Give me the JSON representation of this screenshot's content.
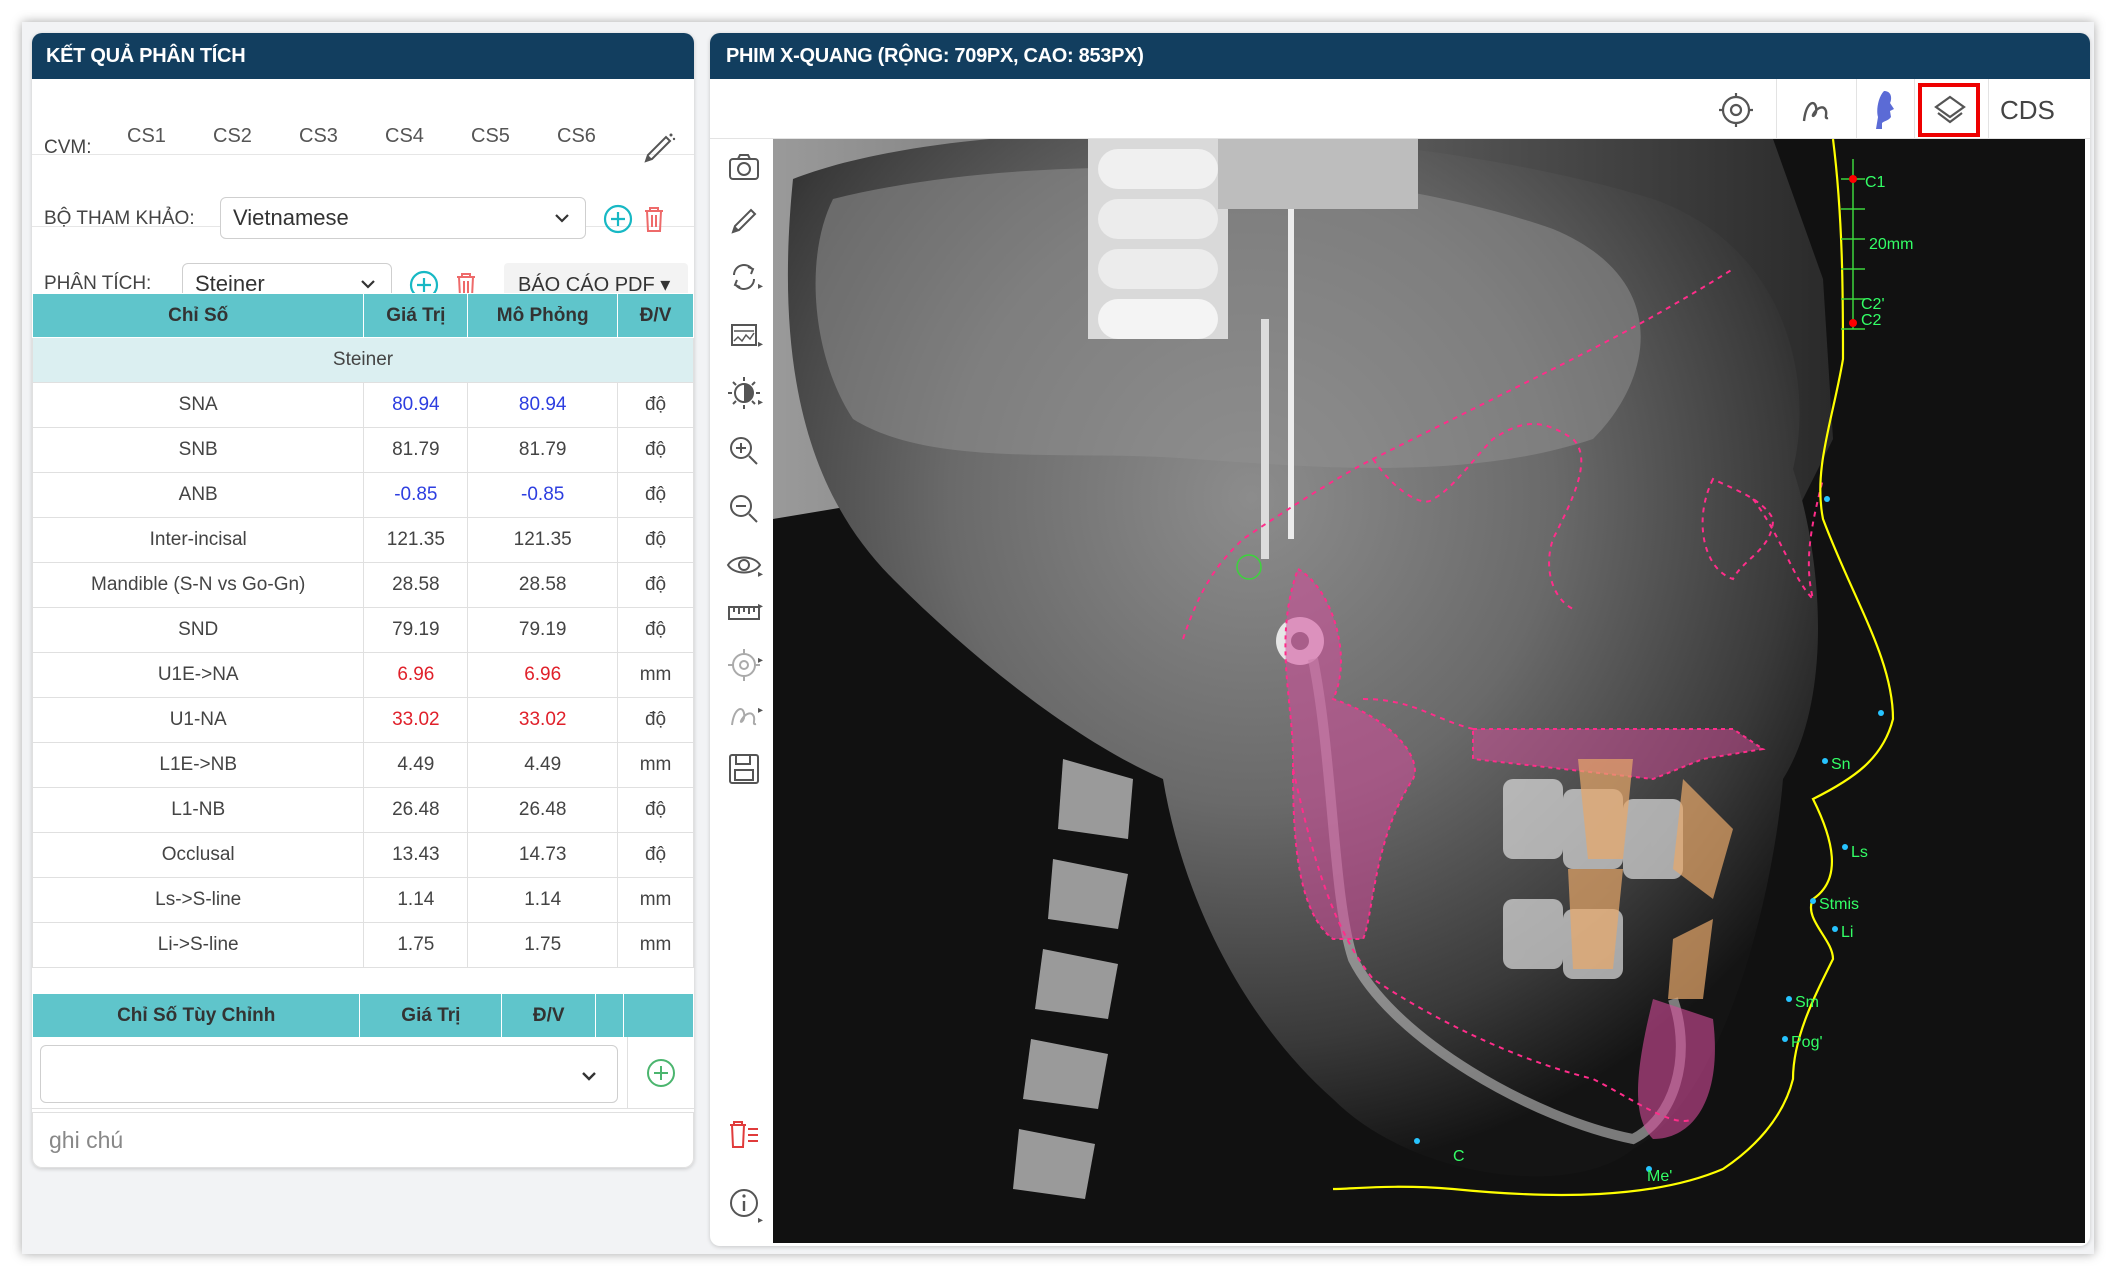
{
  "left_panel": {
    "title": "KẾT QUẢ PHÂN TÍCH",
    "cvm": {
      "label": "CVM:",
      "items": [
        "CS1",
        "CS2",
        "CS3",
        "CS4",
        "CS5",
        "CS6"
      ]
    },
    "reference": {
      "label": "BỘ THAM KHẢO:",
      "value": "Vietnamese"
    },
    "analysis": {
      "label": "PHÂN TÍCH:",
      "value": "Steiner",
      "pdf_label": "BÁO CÁO PDF ▾"
    },
    "table": {
      "headers": [
        "Chỉ Số",
        "Giá Trị",
        "Mô Phỏng",
        "Đ/V"
      ],
      "group": "Steiner",
      "rows": [
        {
          "name": "SNA",
          "value": "80.94",
          "sim": "80.94",
          "unit": "độ",
          "status": "blue"
        },
        {
          "name": "SNB",
          "value": "81.79",
          "sim": "81.79",
          "unit": "độ",
          "status": "normal"
        },
        {
          "name": "ANB",
          "value": "-0.85",
          "sim": "-0.85",
          "unit": "độ",
          "status": "blue"
        },
        {
          "name": "Inter-incisal",
          "value": "121.35",
          "sim": "121.35",
          "unit": "độ",
          "status": "normal"
        },
        {
          "name": "Mandible (S-N vs Go-Gn)",
          "value": "28.58",
          "sim": "28.58",
          "unit": "độ",
          "status": "normal"
        },
        {
          "name": "SND",
          "value": "79.19",
          "sim": "79.19",
          "unit": "độ",
          "status": "normal"
        },
        {
          "name": "U1E->NA",
          "value": "6.96",
          "sim": "6.96",
          "unit": "mm",
          "status": "red"
        },
        {
          "name": "U1-NA",
          "value": "33.02",
          "sim": "33.02",
          "unit": "độ",
          "status": "red"
        },
        {
          "name": "L1E->NB",
          "value": "4.49",
          "sim": "4.49",
          "unit": "mm",
          "status": "normal"
        },
        {
          "name": "L1-NB",
          "value": "26.48",
          "sim": "26.48",
          "unit": "độ",
          "status": "normal"
        },
        {
          "name": "Occlusal",
          "value": "13.43",
          "sim": "14.73",
          "unit": "độ",
          "status": "normal"
        },
        {
          "name": "Ls->S-line",
          "value": "1.14",
          "sim": "1.14",
          "unit": "mm",
          "status": "normal"
        },
        {
          "name": "Li->S-line",
          "value": "1.75",
          "sim": "1.75",
          "unit": "mm",
          "status": "normal"
        }
      ]
    },
    "custom": {
      "headers": [
        "Chỉ Số Tùy Chỉnh",
        "Giá Trị",
        "Đ/V"
      ]
    },
    "note_placeholder": "ghi chú"
  },
  "right_panel": {
    "title": "PHIM X-QUANG (RỘNG: 709PX, CAO: 853PX)",
    "cds_label": "CDS",
    "xray_labels": [
      "C1",
      "20mm",
      "C2'",
      "C2",
      "Sn",
      "Ls",
      "Stmis",
      "Li",
      "Sm",
      "Pog'",
      "Me'",
      "C"
    ]
  },
  "colors": {
    "header_bg": "#123e5f",
    "table_header": "#5fc5cb",
    "group_row": "#dbeff1",
    "accent": "#17b8c4",
    "danger": "#e0202a",
    "low": "#2d3ee0"
  }
}
